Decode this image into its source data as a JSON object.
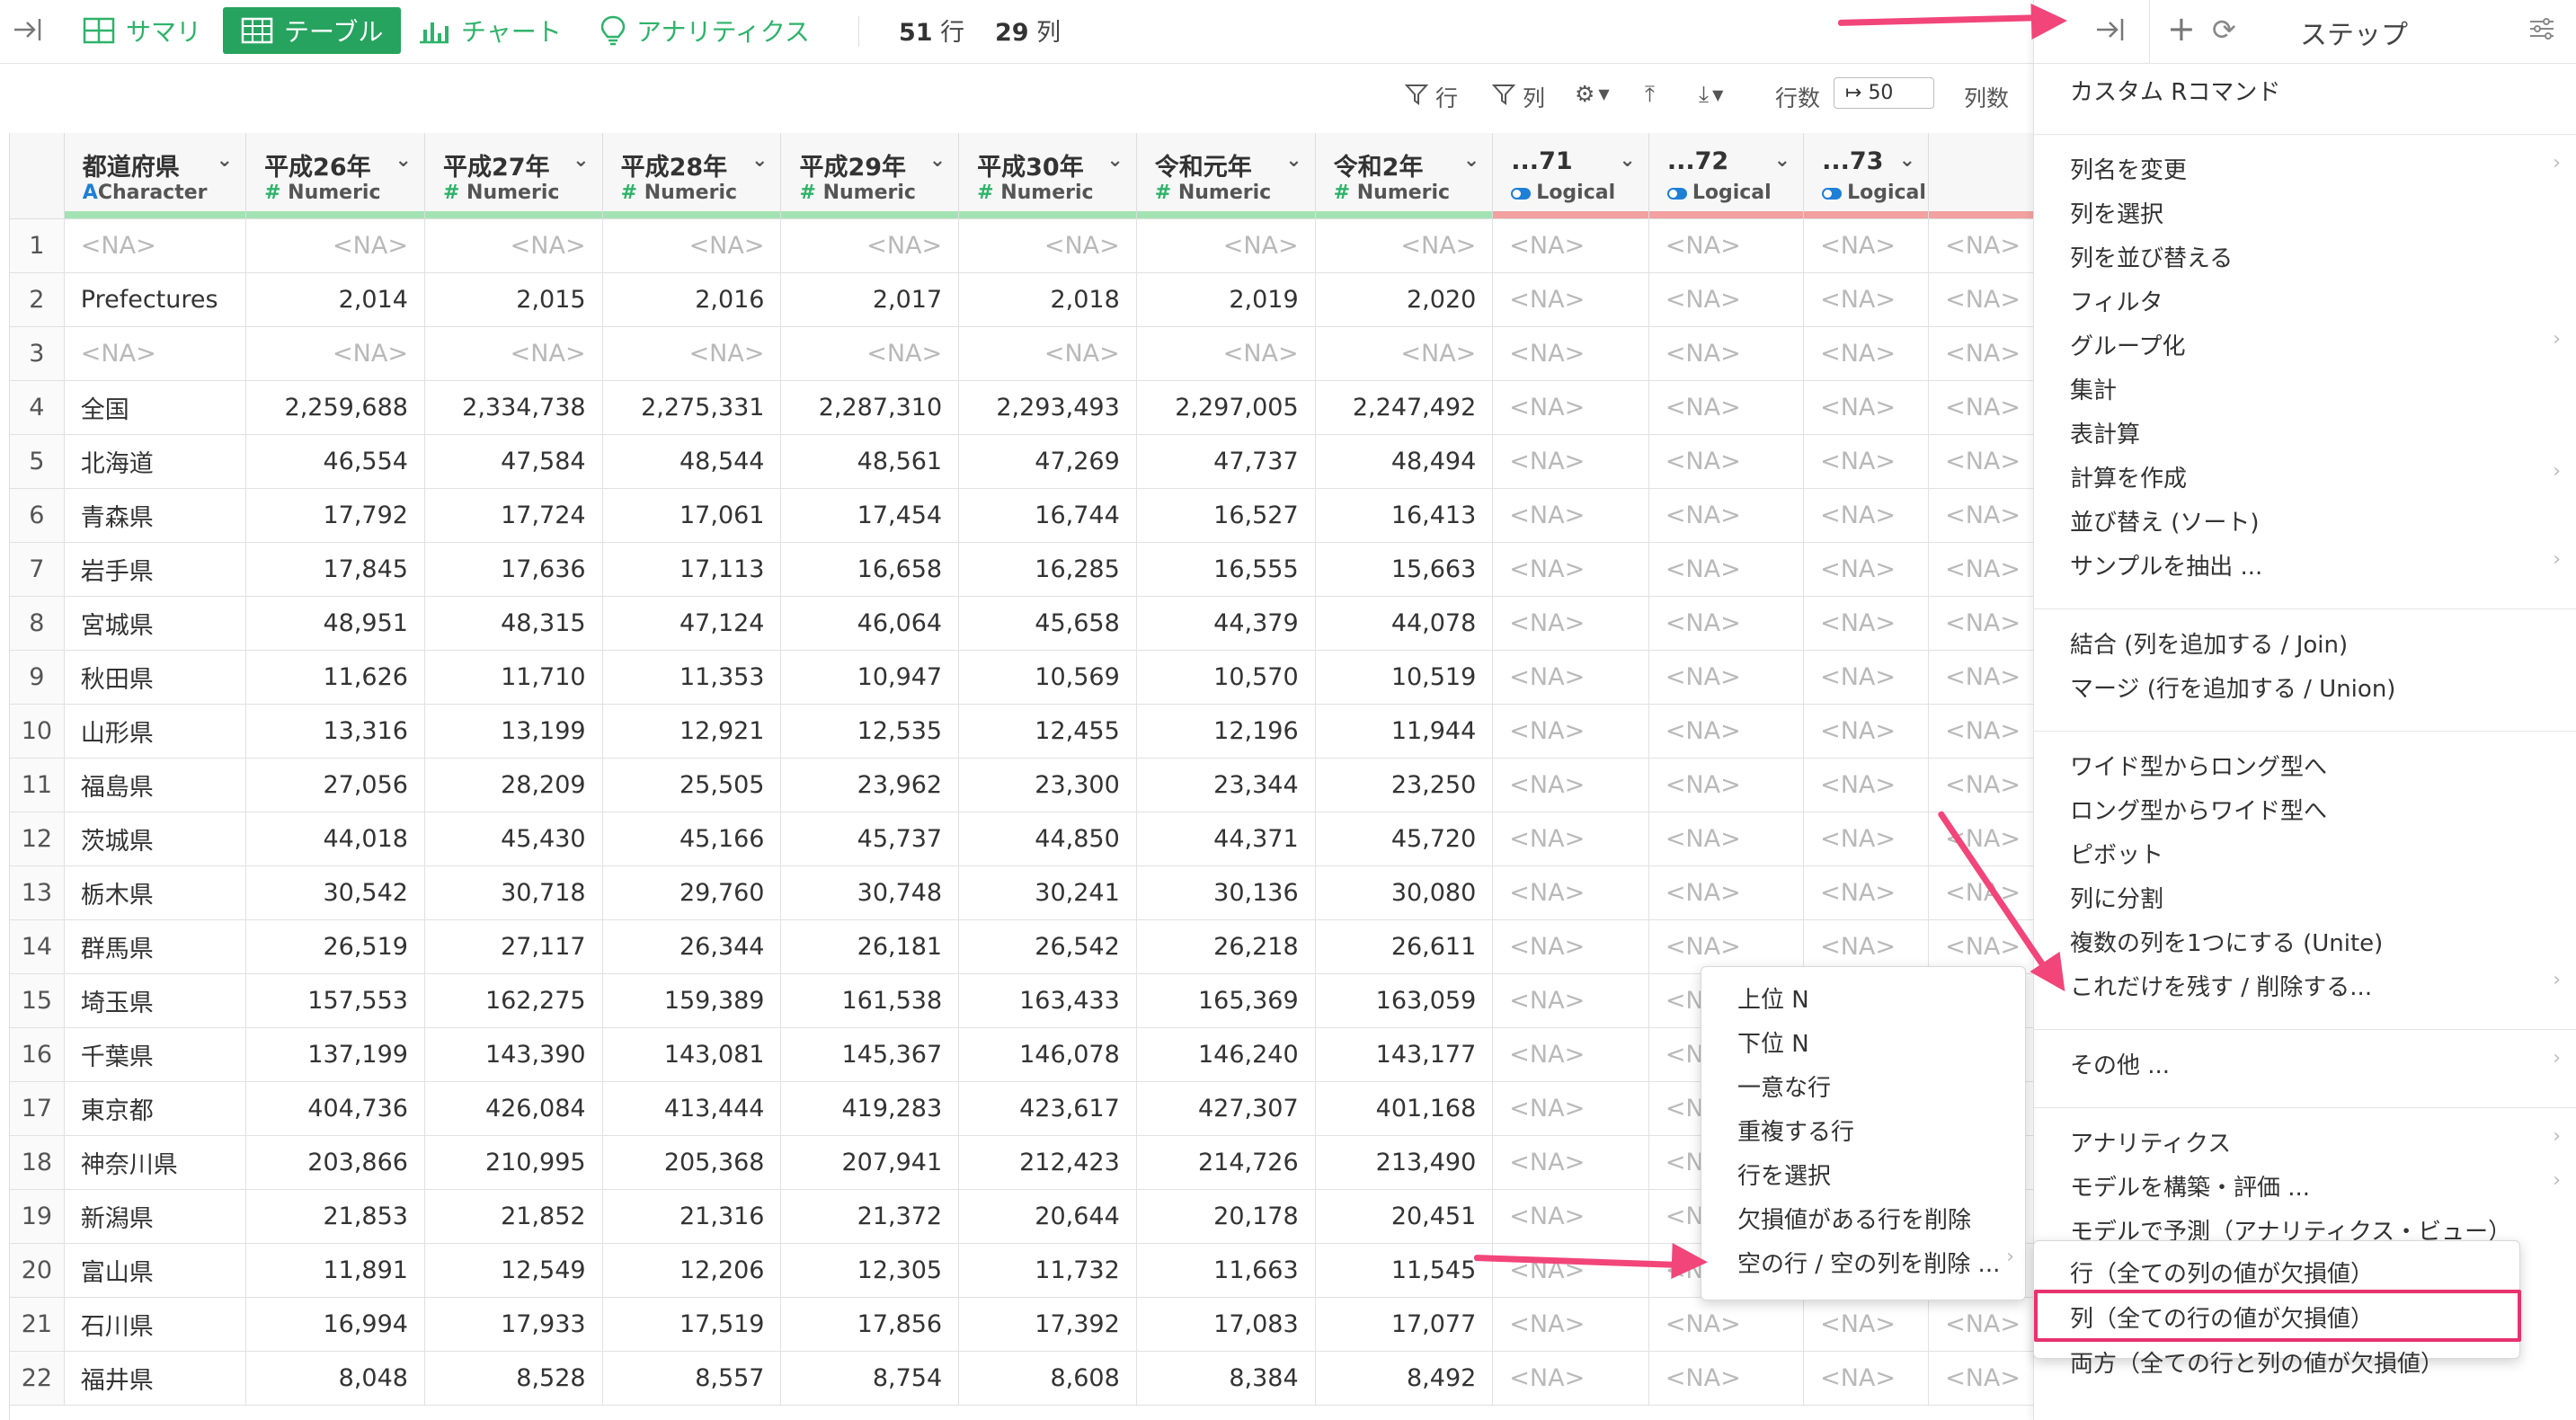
{
  "toolbar": {
    "summary_label": "サマリ",
    "table_label": "テーブル",
    "chart_label": "チャート",
    "analytics_label": "アナリティクス",
    "rows_count": "51",
    "rows_unit": "行",
    "cols_count": "29",
    "cols_unit": "列"
  },
  "table_toolbar": {
    "filter_rows": "行",
    "filter_cols": "列",
    "row_count_label": "行数",
    "row_count_value": "50",
    "col_count_label": "列数"
  },
  "right_header": {
    "steps_label": "ステップ"
  },
  "columns": [
    {
      "name": "都道府県",
      "type": "Character",
      "kind": "chr"
    },
    {
      "name": "平成26年",
      "type": "Numeric",
      "kind": "num"
    },
    {
      "name": "平成27年",
      "type": "Numeric",
      "kind": "num"
    },
    {
      "name": "平成28年",
      "type": "Numeric",
      "kind": "num"
    },
    {
      "name": "平成29年",
      "type": "Numeric",
      "kind": "num"
    },
    {
      "name": "平成30年",
      "type": "Numeric",
      "kind": "num"
    },
    {
      "name": "令和元年",
      "type": "Numeric",
      "kind": "num"
    },
    {
      "name": "令和2年",
      "type": "Numeric",
      "kind": "num"
    },
    {
      "name": "...71",
      "type": "Logical",
      "kind": "log"
    },
    {
      "name": "...72",
      "type": "Logical",
      "kind": "log"
    },
    {
      "name": "...73",
      "type": "Logical",
      "kind": "log"
    }
  ],
  "na": "<NA>",
  "rows": [
    [
      "1",
      "<NA>",
      "<NA>",
      "<NA>",
      "<NA>",
      "<NA>",
      "<NA>",
      "<NA>",
      "<NA>"
    ],
    [
      "2",
      "Prefectures",
      "2,014",
      "2,015",
      "2,016",
      "2,017",
      "2,018",
      "2,019",
      "2,020"
    ],
    [
      "3",
      "<NA>",
      "<NA>",
      "<NA>",
      "<NA>",
      "<NA>",
      "<NA>",
      "<NA>",
      "<NA>"
    ],
    [
      "4",
      "全国",
      "2,259,688",
      "2,334,738",
      "2,275,331",
      "2,287,310",
      "2,293,493",
      "2,297,005",
      "2,247,492"
    ],
    [
      "5",
      "北海道",
      "46,554",
      "47,584",
      "48,544",
      "48,561",
      "47,269",
      "47,737",
      "48,494"
    ],
    [
      "6",
      "青森県",
      "17,792",
      "17,724",
      "17,061",
      "17,454",
      "16,744",
      "16,527",
      "16,413"
    ],
    [
      "7",
      "岩手県",
      "17,845",
      "17,636",
      "17,113",
      "16,658",
      "16,285",
      "16,555",
      "15,663"
    ],
    [
      "8",
      "宮城県",
      "48,951",
      "48,315",
      "47,124",
      "46,064",
      "45,658",
      "44,379",
      "44,078"
    ],
    [
      "9",
      "秋田県",
      "11,626",
      "11,710",
      "11,353",
      "10,947",
      "10,569",
      "10,570",
      "10,519"
    ],
    [
      "10",
      "山形県",
      "13,316",
      "13,199",
      "12,921",
      "12,535",
      "12,455",
      "12,196",
      "11,944"
    ],
    [
      "11",
      "福島県",
      "27,056",
      "28,209",
      "25,505",
      "23,962",
      "23,300",
      "23,344",
      "23,250"
    ],
    [
      "12",
      "茨城県",
      "44,018",
      "45,430",
      "45,166",
      "45,737",
      "44,850",
      "44,371",
      "45,720"
    ],
    [
      "13",
      "栃木県",
      "30,542",
      "30,718",
      "29,760",
      "30,748",
      "30,241",
      "30,136",
      "30,080"
    ],
    [
      "14",
      "群馬県",
      "26,519",
      "27,117",
      "26,344",
      "26,181",
      "26,542",
      "26,218",
      "26,611"
    ],
    [
      "15",
      "埼玉県",
      "157,553",
      "162,275",
      "159,389",
      "161,538",
      "163,433",
      "165,369",
      "163,059"
    ],
    [
      "16",
      "千葉県",
      "137,199",
      "143,390",
      "143,081",
      "145,367",
      "146,078",
      "146,240",
      "143,177"
    ],
    [
      "17",
      "東京都",
      "404,736",
      "426,084",
      "413,444",
      "419,283",
      "423,617",
      "427,307",
      "401,168"
    ],
    [
      "18",
      "神奈川県",
      "203,866",
      "210,995",
      "205,368",
      "207,941",
      "212,423",
      "214,726",
      "213,490"
    ],
    [
      "19",
      "新潟県",
      "21,853",
      "21,852",
      "21,316",
      "21,372",
      "20,644",
      "20,178",
      "20,451"
    ],
    [
      "20",
      "富山県",
      "11,891",
      "12,549",
      "12,206",
      "12,305",
      "11,732",
      "11,663",
      "11,545"
    ],
    [
      "21",
      "石川県",
      "16,994",
      "17,933",
      "17,519",
      "17,856",
      "17,392",
      "17,083",
      "17,077"
    ],
    [
      "22",
      "福井県",
      "8,048",
      "8,528",
      "8,557",
      "8,754",
      "8,608",
      "8,384",
      "8,492"
    ]
  ],
  "main_menu": [
    {
      "label": "カスタム Rコマンド",
      "arrow": false
    },
    {
      "sep": true
    },
    {
      "label": "列名を変更",
      "arrow": true
    },
    {
      "label": "列を選択",
      "arrow": false
    },
    {
      "label": "列を並び替える",
      "arrow": false
    },
    {
      "label": "フィルタ",
      "arrow": false
    },
    {
      "label": "グループ化",
      "arrow": true
    },
    {
      "label": "集計",
      "arrow": false
    },
    {
      "label": "表計算",
      "arrow": false
    },
    {
      "label": "計算を作成",
      "arrow": true
    },
    {
      "label": "並び替え (ソート)",
      "arrow": false
    },
    {
      "label": "サンプルを抽出 ...",
      "arrow": true
    },
    {
      "sep": true
    },
    {
      "label": "結合 (列を追加する / Join)",
      "arrow": false
    },
    {
      "label": "マージ (行を追加する / Union)",
      "arrow": false
    },
    {
      "sep": true
    },
    {
      "label": "ワイド型からロング型へ",
      "arrow": false
    },
    {
      "label": "ロング型からワイド型へ",
      "arrow": false
    },
    {
      "label": "ピボット",
      "arrow": false
    },
    {
      "label": "列に分割",
      "arrow": false
    },
    {
      "label": "複数の列を1つにする (Unite)",
      "arrow": false
    },
    {
      "label": "これだけを残す / 削除する...",
      "arrow": true
    },
    {
      "sep": true
    },
    {
      "label": "その他 ...",
      "arrow": true
    },
    {
      "sep": true
    },
    {
      "label": "アナリティクス",
      "arrow": true
    },
    {
      "label": "モデルを構築・評価 ...",
      "arrow": true
    },
    {
      "label": "モデルで予測（アナリティクス・ビュー）",
      "arrow": false
    }
  ],
  "sub_menu": [
    {
      "label": "上位 N",
      "arrow": false
    },
    {
      "label": "下位 N",
      "arrow": false
    },
    {
      "label": "一意な行",
      "arrow": false
    },
    {
      "label": "重複する行",
      "arrow": false
    },
    {
      "label": "行を選択",
      "arrow": false
    },
    {
      "label": "欠損値がある行を削除",
      "arrow": false
    },
    {
      "label": "空の行 / 空の列を削除 ...",
      "arrow": true
    }
  ],
  "sub_sub_menu": [
    {
      "label": "行（全ての列の値が欠損値）"
    },
    {
      "label": "列（全ての行の値が欠損値）"
    },
    {
      "label": "両方（全ての行と列の値が欠損値）"
    }
  ],
  "highlight_color": "#e8326e"
}
